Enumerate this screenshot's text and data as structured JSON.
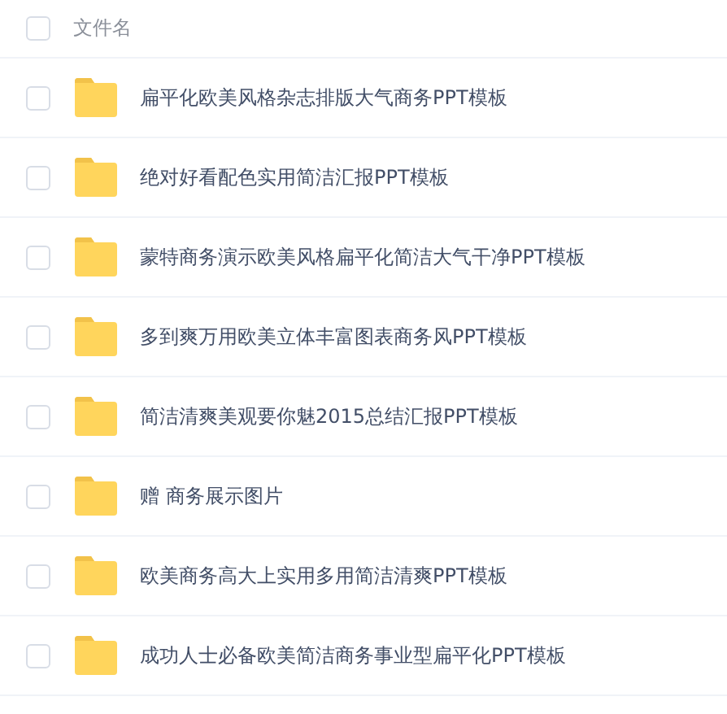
{
  "header": {
    "checked": false,
    "label": "文件名"
  },
  "files": [
    {
      "name": "扁平化欧美风格杂志排版大气商务PPT模板",
      "checked": false,
      "kind": "folder"
    },
    {
      "name": "绝对好看配色实用简洁汇报PPT模板",
      "checked": false,
      "kind": "folder"
    },
    {
      "name": "蒙特商务演示欧美风格扁平化简洁大气干净PPT模板",
      "checked": false,
      "kind": "folder"
    },
    {
      "name": "多到爽万用欧美立体丰富图表商务风PPT模板",
      "checked": false,
      "kind": "folder"
    },
    {
      "name": "简洁清爽美观要你魅2015总结汇报PPT模板",
      "checked": false,
      "kind": "folder"
    },
    {
      "name": "赠 商务展示图片",
      "checked": false,
      "kind": "folder"
    },
    {
      "name": "欧美商务高大上实用多用简洁清爽PPT模板",
      "checked": false,
      "kind": "folder"
    },
    {
      "name": "成功人士必备欧美简洁商务事业型扁平化PPT模板",
      "checked": false,
      "kind": "folder"
    }
  ]
}
